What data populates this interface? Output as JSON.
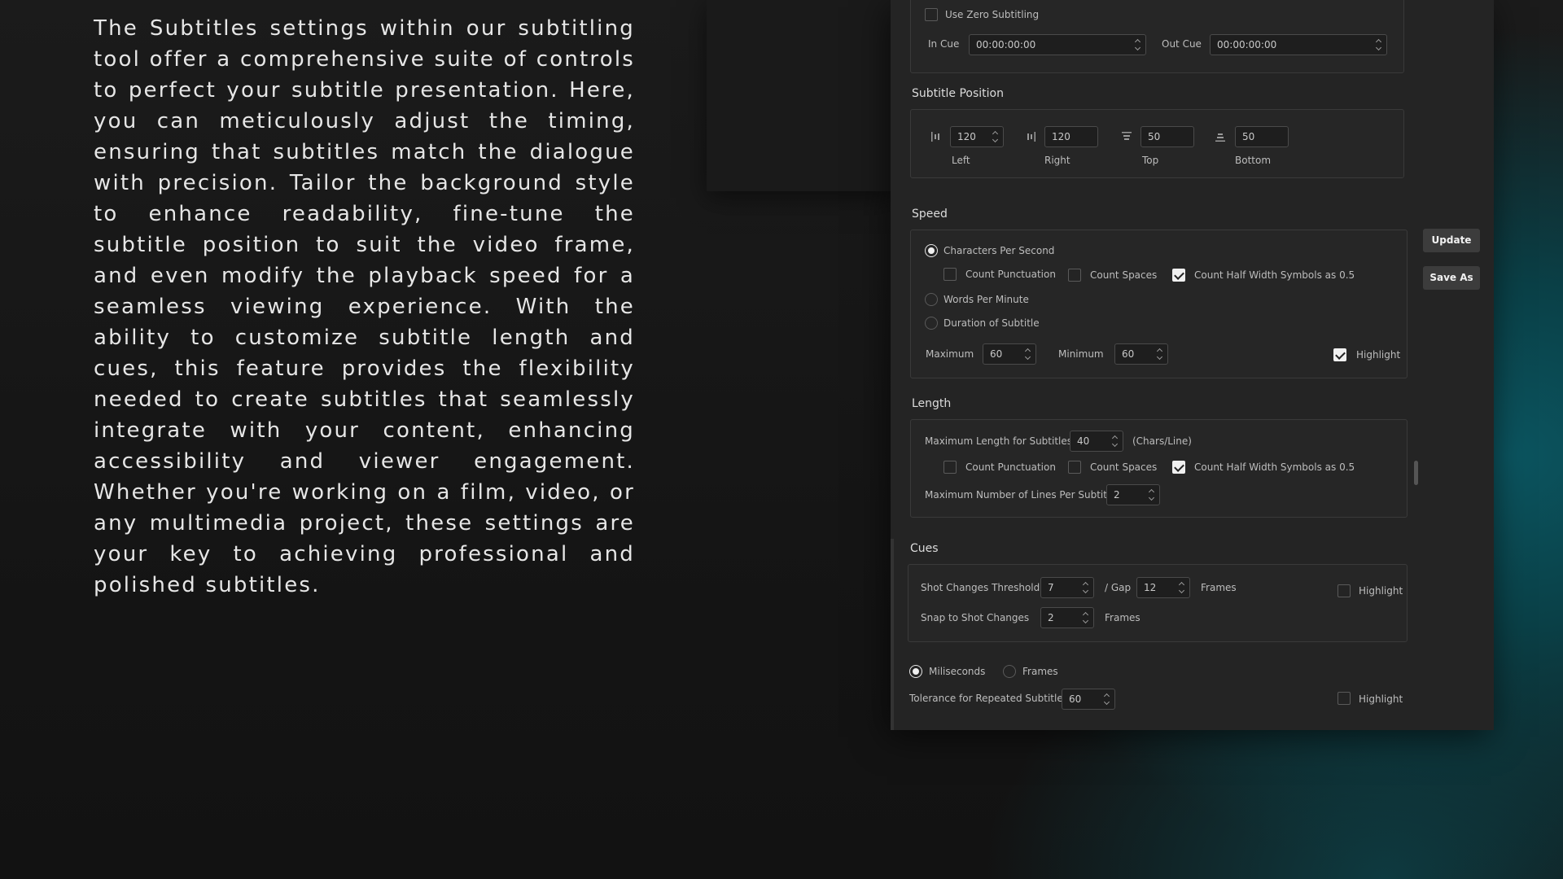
{
  "marketing_text": "The Subtitles settings within our subtitling tool offer a comprehensive suite of controls to perfect your subtitle presentation. Here, you can meticulously adjust the timing, ensuring that subtitles match the dialogue with precision. Tailor the background style to enhance readability, fine-tune the subtitle position to suit the video frame, and even modify the playback speed for a seamless viewing experience. With the ability to customize subtitle length and cues, this feature provides the flexibility needed to create subtitles that seamlessly integrate with your content, enhancing accessibility and viewer engagement. Whether you're working on a film, video, or any multimedia project, these settings are your key to achieving professional and polished subtitles.",
  "timing": {
    "use_zero_label": "Use Zero Subtitling",
    "use_zero_checked": false,
    "in_cue_label": "In Cue",
    "in_cue_value": "00:00:00:00",
    "out_cue_label": "Out Cue",
    "out_cue_value": "00:00:00:00"
  },
  "position": {
    "title": "Subtitle Position",
    "left_value": "120",
    "left_label": "Left",
    "right_value": "120",
    "right_label": "Right",
    "top_value": "50",
    "top_label": "Top",
    "bottom_value": "50",
    "bottom_label": "Bottom"
  },
  "speed": {
    "title": "Speed",
    "cps_label": "Characters Per Second",
    "count_punct_label": "Count Punctuation",
    "count_spaces_label": "Count Spaces",
    "count_half_label": "Count Half Width Symbols as 0.5",
    "wpm_label": "Words Per Minute",
    "duration_label": "Duration of Subtitle",
    "maximum_label": "Maximum",
    "maximum_value": "60",
    "minimum_label": "Minimum",
    "minimum_value": "60",
    "highlight_label": "Highlight"
  },
  "length": {
    "title": "Length",
    "max_len_label": "Maximum Length for Subtitles",
    "max_len_value": "40",
    "max_len_unit": "(Chars/Line)",
    "count_punct_label": "Count Punctuation",
    "count_spaces_label": "Count Spaces",
    "count_half_label": "Count Half Width Symbols as 0.5",
    "max_lines_label": "Maximum Number of Lines Per Subtitle",
    "max_lines_value": "2"
  },
  "cues": {
    "title": "Cues",
    "shot_threshold_label": "Shot Changes Threshold",
    "shot_threshold_value": "7",
    "gap_label": "/ Gap",
    "gap_value": "12",
    "frames_label": "Frames",
    "highlight_label": "Highlight",
    "snap_label": "Snap to Shot Changes",
    "snap_value": "2",
    "snap_unit": "Frames"
  },
  "tolerance": {
    "ms_label": "Miliseconds",
    "frames_label": "Frames",
    "tolerance_label": "Tolerance for Repeated Subtitles",
    "tolerance_value": "60",
    "highlight_label": "Highlight"
  },
  "actions": {
    "update_label": "Update",
    "save_as_label": "Save As"
  }
}
